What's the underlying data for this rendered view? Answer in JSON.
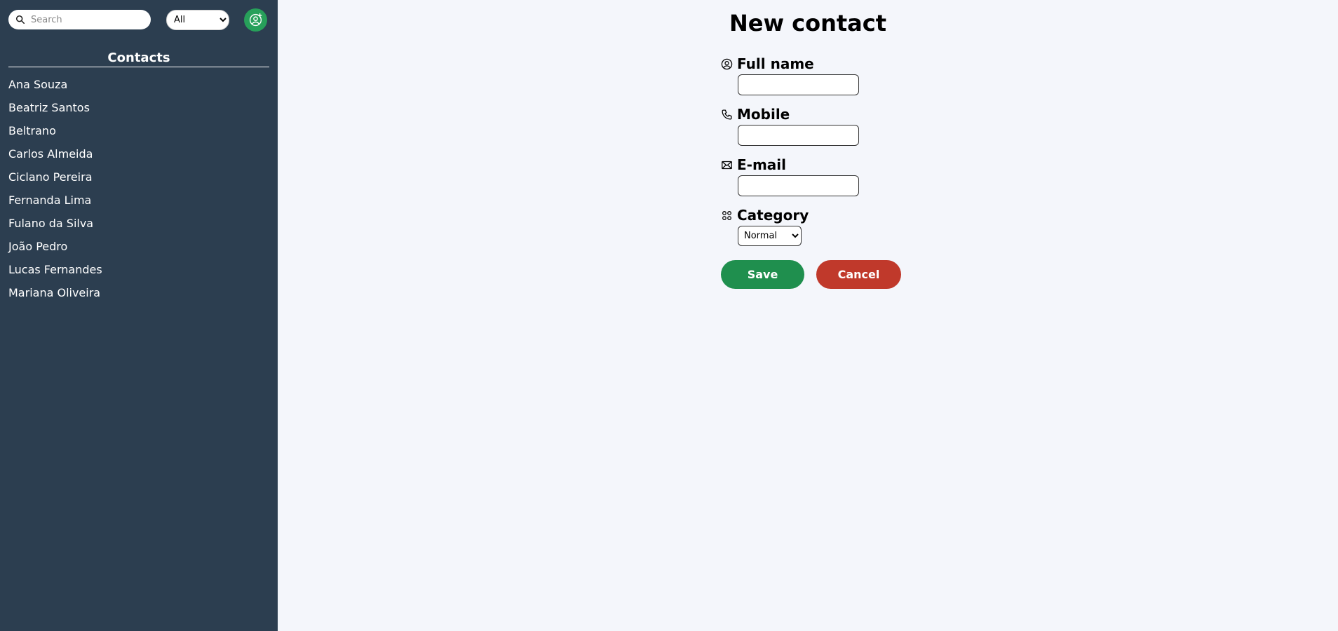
{
  "sidebar": {
    "search_placeholder": "Search",
    "filter_selected": "All",
    "contacts_heading": "Contacts",
    "contacts": [
      "Ana Souza",
      "Beatriz Santos",
      "Beltrano",
      "Carlos Almeida",
      "Ciclano Pereira",
      "Fernanda Lima",
      "Fulano da Silva",
      "João Pedro",
      "Lucas Fernandes",
      "Mariana Oliveira"
    ],
    "icons": {
      "search": "search-icon",
      "add_contact": "user-plus-icon"
    }
  },
  "main": {
    "title": "New contact",
    "fields": {
      "full_name": {
        "label": "Full name",
        "value": "",
        "icon": "user-circle-icon"
      },
      "mobile": {
        "label": "Mobile",
        "value": "",
        "icon": "phone-icon"
      },
      "email": {
        "label": "E-mail",
        "value": "",
        "icon": "envelope-icon"
      },
      "category": {
        "label": "Category",
        "selected": "Normal",
        "icon": "category-icon"
      }
    },
    "save_label": "Save",
    "cancel_label": "Cancel"
  },
  "colors": {
    "sidebar_bg": "#2c3e50",
    "main_bg": "#f4f6fb",
    "accent_green": "#27a05a",
    "save_green": "#1f8f4e",
    "cancel_red": "#c0392b"
  }
}
